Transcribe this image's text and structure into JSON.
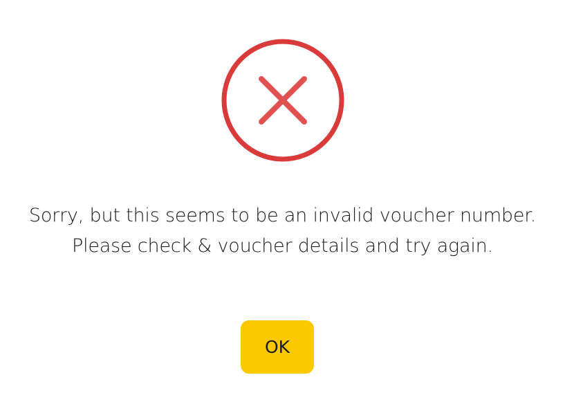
{
  "dialog": {
    "icon": "error-x-circle-icon",
    "icon_color": "#d93a3a",
    "message": "Sorry, but this seems to be an invalid voucher number. Please check & voucher details and try again.",
    "ok_label": "OK",
    "button_color": "#fcc800"
  }
}
